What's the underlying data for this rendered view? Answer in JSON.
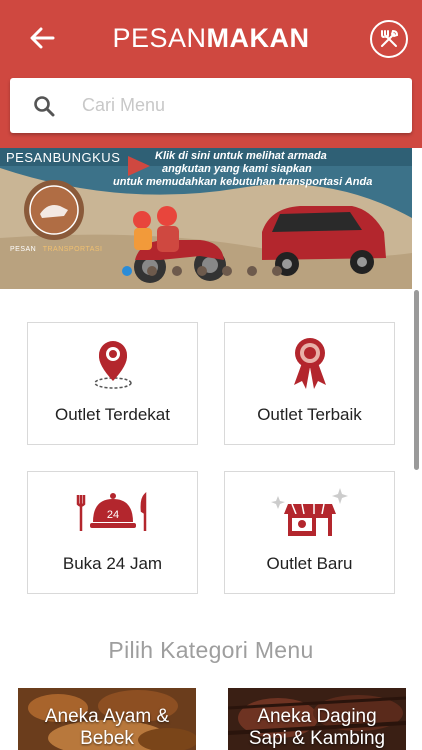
{
  "header": {
    "brand_light": "PESAN",
    "brand_bold": "MAKAN"
  },
  "search": {
    "placeholder": "Cari Menu"
  },
  "banner": {
    "tag": "PESANBUNGKUS",
    "line1": "Klik di sini untuk melihat armada",
    "line2": "angkutan yang kami siapkan",
    "line3": "untuk memudahkan kebutuhan transportasi Anda",
    "logo_caption_a": "PESAN",
    "logo_caption_b": "TRANSPORTASI",
    "active_slide": 1,
    "slide_count": 7
  },
  "tiles": [
    {
      "label": "Outlet Terdekat",
      "icon": "location-pin-icon"
    },
    {
      "label": "Outlet Terbaik",
      "icon": "award-ribbon-icon"
    },
    {
      "label": "Buka 24 Jam",
      "icon": "cloche-24-icon"
    },
    {
      "label": "Outlet Baru",
      "icon": "new-store-icon"
    }
  ],
  "section_title": "Pilih Kategori Menu",
  "categories": [
    {
      "line1": "Aneka Ayam &",
      "line2": "Bebek"
    },
    {
      "line1": "Aneka Daging",
      "line2": "Sapi & Kambing"
    }
  ],
  "colors": {
    "primary": "#cf4840",
    "icon_red": "#b3262d",
    "banner_teal": "#3c7289"
  }
}
